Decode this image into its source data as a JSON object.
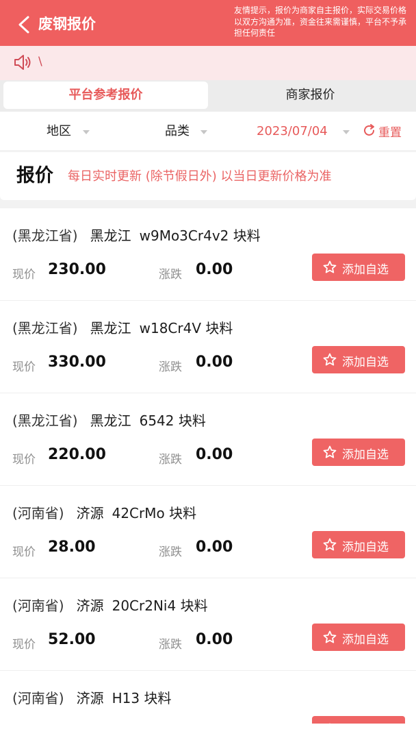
{
  "header": {
    "title": "废钢报价",
    "notice": "友情提示，报价为商家自主报价，实际交易价格以双方沟通为准，资金往来需谨慎，平台不予承担任何责任",
    "back_icon": "chevron-left-icon"
  },
  "announcement": {
    "icon": "speaker-icon",
    "text": "\\"
  },
  "tabs": [
    "平台参考报价",
    "商家报价"
  ],
  "filters": {
    "region": "地区",
    "category": "品类",
    "date": "2023/07/04",
    "reset": "重置"
  },
  "quote": {
    "title": "报价",
    "subtitle": "每日实时更新 (除节假日外) 以当日更新价格为准"
  },
  "labels": {
    "price": "现价",
    "change": "涨跌",
    "add": "添加自选"
  },
  "items": [
    {
      "province": "(黑龙江省)",
      "city": "黑龙江",
      "product": "w9Mo3Cr4v2 块料",
      "price": "230.00",
      "change": "0.00"
    },
    {
      "province": "(黑龙江省)",
      "city": "黑龙江",
      "product": "w18Cr4V 块料",
      "price": "330.00",
      "change": "0.00"
    },
    {
      "province": "(黑龙江省)",
      "city": "黑龙江",
      "product": "6542 块料",
      "price": "220.00",
      "change": "0.00"
    },
    {
      "province": "(河南省)",
      "city": "济源",
      "product": "42CrMo 块料",
      "price": "28.00",
      "change": "0.00"
    },
    {
      "province": "(河南省)",
      "city": "济源",
      "product": "20Cr2Ni4 块料",
      "price": "52.00",
      "change": "0.00"
    },
    {
      "province": "(河南省)",
      "city": "济源",
      "product": "H13 块料",
      "price": "",
      "change": ""
    }
  ],
  "colors": {
    "brand": "#ef5f5f",
    "accent": "#e75a5a",
    "button": "#ef6464",
    "announcement_bg": "#fbe8ea"
  }
}
